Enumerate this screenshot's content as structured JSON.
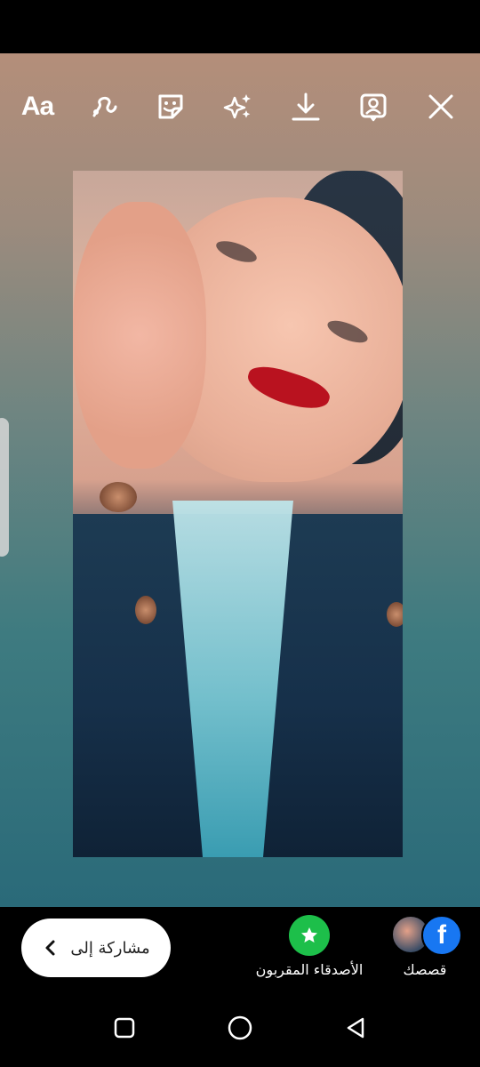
{
  "toolbar": {
    "text_tool_label": "Aa",
    "icons": [
      "text-tool",
      "draw-icon",
      "sticker-icon",
      "effects-icon",
      "download-icon",
      "tag-person-icon",
      "close-icon"
    ]
  },
  "share": {
    "share_button_label": "مشاركة إلى",
    "close_friends_label": "الأصدقاء المقربون",
    "your_story_label": "قصصك"
  },
  "colors": {
    "close_friends_green": "#1dbf4a",
    "facebook_blue": "#1877f2"
  }
}
